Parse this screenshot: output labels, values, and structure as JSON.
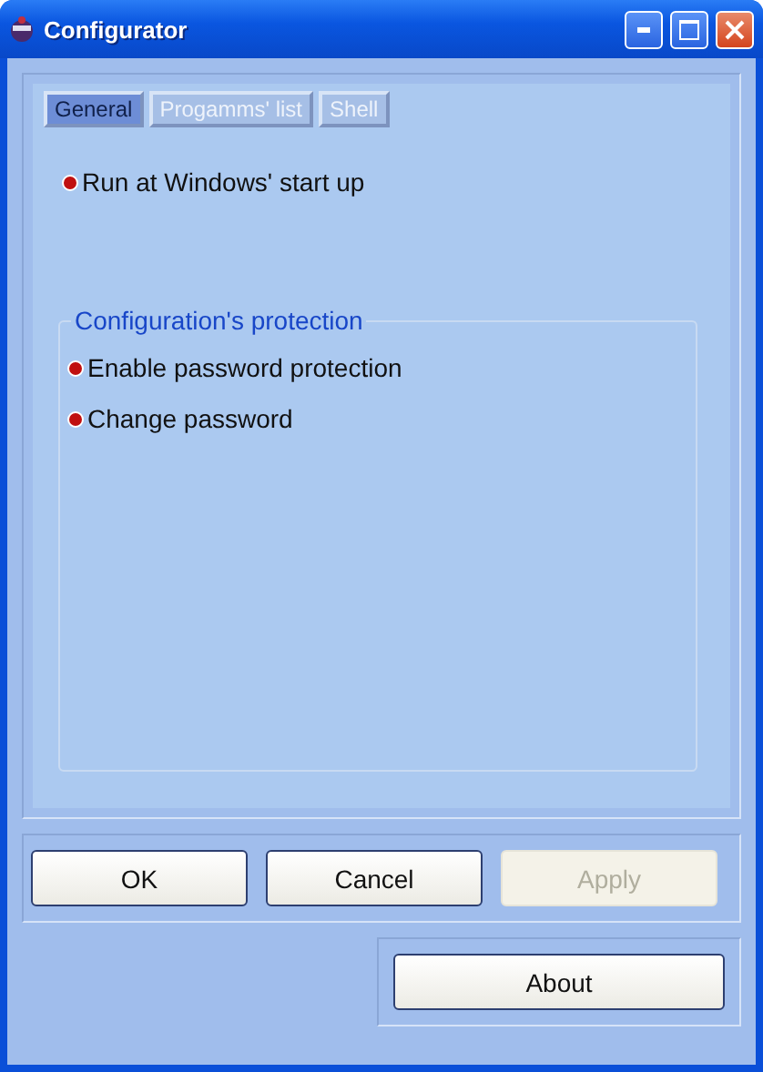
{
  "window": {
    "title": "Configurator"
  },
  "tabs": [
    {
      "label": "General",
      "selected": true
    },
    {
      "label": "Progamms' list",
      "selected": false
    },
    {
      "label": "Shell",
      "selected": false
    }
  ],
  "options": [
    {
      "label": "Run at Windows' start up"
    }
  ],
  "protection": {
    "title": "Configuration's protection",
    "options": [
      {
        "label": "Enable password protection"
      },
      {
        "label": "Change password"
      }
    ]
  },
  "buttons": [
    {
      "label": "OK",
      "disabled": false
    },
    {
      "label": "Cancel",
      "disabled": false
    },
    {
      "label": "Apply",
      "disabled": true
    }
  ],
  "about_button": {
    "label": "About"
  }
}
